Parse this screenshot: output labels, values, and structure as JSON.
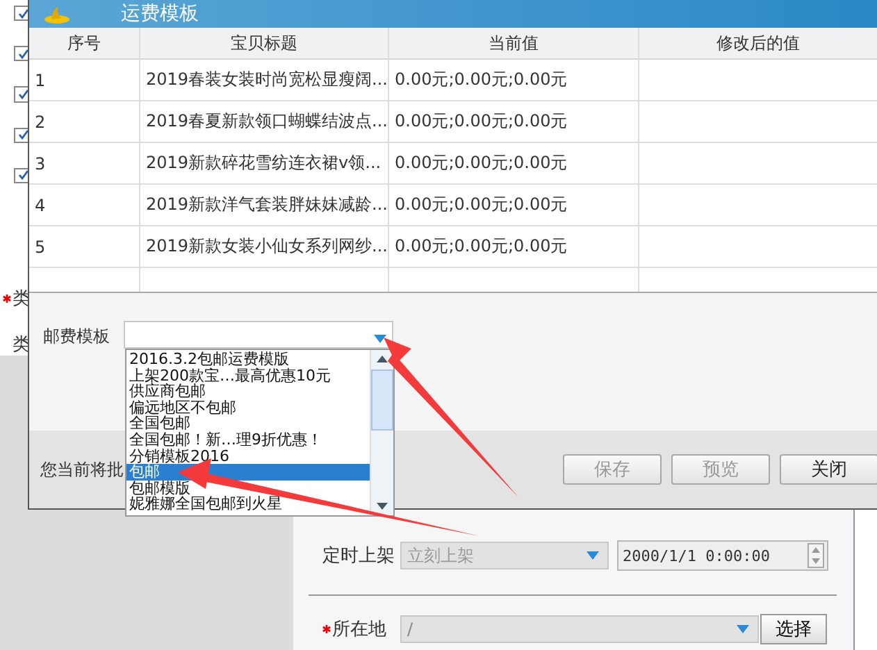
{
  "background": {
    "checkboxes": [
      {
        "checked": true
      },
      {
        "checked": true
      },
      {
        "checked": true
      },
      {
        "checked": true
      },
      {
        "checked": true
      }
    ],
    "side_labels": [
      {
        "text": "类",
        "required": true
      },
      {
        "text": "类",
        "required": false
      }
    ],
    "schedule": {
      "label": "定时上架",
      "select": "立刻上架",
      "datetime": "2000/1/1 0:00:00"
    },
    "location": {
      "label": "所在地",
      "required": true,
      "value": "/",
      "button": "选择"
    }
  },
  "dialog": {
    "title": "运费模板",
    "columns": [
      "序号",
      "宝贝标题",
      "当前值",
      "修改后的值"
    ],
    "rows": [
      {
        "no": "1",
        "title": "2019春装女装时尚宽松显瘦阔...",
        "current": "0.00元;0.00元;0.00元"
      },
      {
        "no": "2",
        "title": "2019春夏新款领口蝴蝶结波点...",
        "current": "0.00元;0.00元;0.00元"
      },
      {
        "no": "3",
        "title": "2019新款碎花雪纺连衣裙v领...",
        "current": "0.00元;0.00元;0.00元"
      },
      {
        "no": "4",
        "title": "2019新款洋气套装胖妹妹减龄...",
        "current": "0.00元;0.00元;0.00元"
      },
      {
        "no": "5",
        "title": "2019新款女装小仙女系列网纱...",
        "current": "0.00元;0.00元;0.00元"
      }
    ],
    "postage": {
      "label": "邮费模板",
      "options": [
        {
          "label": "2016.3.2包邮运费模版",
          "selected": false
        },
        {
          "label": "上架200款宝…最高优惠10元",
          "selected": false
        },
        {
          "label": "供应商包邮",
          "selected": false
        },
        {
          "label": "偏远地区不包邮",
          "selected": false
        },
        {
          "label": "全国包邮",
          "selected": false
        },
        {
          "label": "全国包邮！新…理9折优惠！",
          "selected": false
        },
        {
          "label": "分销模板2016",
          "selected": false
        },
        {
          "label": "包邮",
          "selected": true
        },
        {
          "label": "包邮模版",
          "selected": false
        },
        {
          "label": "妮雅娜全国包邮到火星",
          "selected": false
        }
      ]
    },
    "footer_text": "您当前将批",
    "buttons": [
      {
        "label": "保存",
        "disabled": true
      },
      {
        "label": "预览",
        "disabled": true
      },
      {
        "label": "关闭",
        "disabled": false
      }
    ]
  }
}
